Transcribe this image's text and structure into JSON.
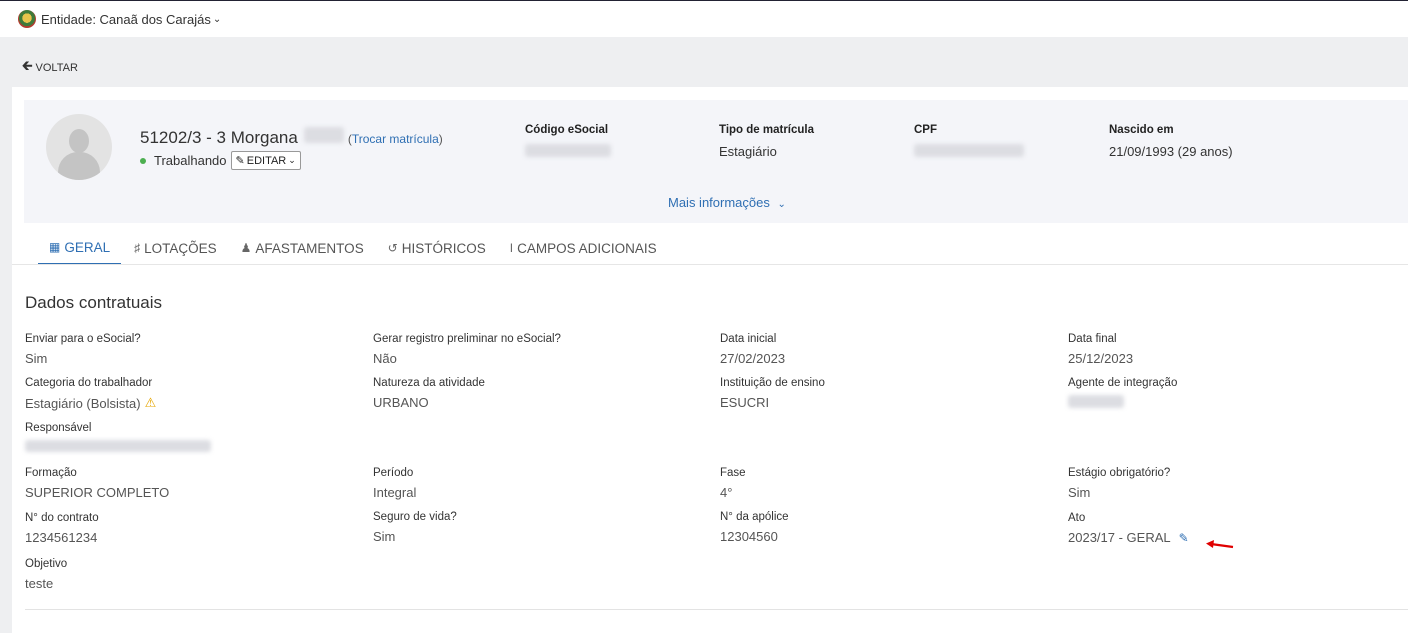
{
  "topbar": {
    "entity_label": "Entidade: Canaã dos Carajás"
  },
  "nav": {
    "back_label": "VOLTAR"
  },
  "profile": {
    "name": "51202/3 - 3 Morgana",
    "trocar_prefix": "(",
    "trocar_link": "Trocar matrícula",
    "trocar_suffix": ")",
    "status": "Trabalhando",
    "edit_label": "EDITAR",
    "fields": {
      "codigo_label": "Código eSocial",
      "tipo_label": "Tipo de matrícula",
      "tipo_value": "Estagiário",
      "cpf_label": "CPF",
      "nascido_label": "Nascido em",
      "nascido_value": "21/09/1993 (29 anos)"
    },
    "mais_info": "Mais informações"
  },
  "tabs": [
    {
      "label": "GERAL",
      "icon": "id-card-icon"
    },
    {
      "label": "LOTAÇÕES",
      "icon": "sitemap-icon"
    },
    {
      "label": "AFASTAMENTOS",
      "icon": "user-x-icon"
    },
    {
      "label": "HISTÓRICOS",
      "icon": "history-icon"
    },
    {
      "label": "CAMPOS ADICIONAIS",
      "icon": "text-cursor-icon"
    }
  ],
  "section": {
    "title": "Dados contratuais",
    "fields": {
      "enviar_l": "Enviar para o eSocial?",
      "enviar_v": "Sim",
      "gerar_l": "Gerar registro preliminar no eSocial?",
      "gerar_v": "Não",
      "dtini_l": "Data inicial",
      "dtini_v": "27/02/2023",
      "dtfim_l": "Data final",
      "dtfim_v": "25/12/2023",
      "categoria_l": "Categoria do trabalhador",
      "categoria_v": "Estagiário (Bolsista)",
      "natureza_l": "Natureza da atividade",
      "natureza_v": "URBANO",
      "instituicao_l": "Instituição de ensino",
      "instituicao_v": "ESUCRI",
      "agente_l": "Agente de integração",
      "responsavel_l": "Responsável",
      "formacao_l": "Formação",
      "formacao_v": "SUPERIOR COMPLETO",
      "periodo_l": "Período",
      "periodo_v": "Integral",
      "fase_l": "Fase",
      "fase_v": "4°",
      "estagio_l": "Estágio obrigatório?",
      "estagio_v": "Sim",
      "contrato_l": "N° do contrato",
      "contrato_v": "1234561234",
      "seguro_l": "Seguro de vida?",
      "seguro_v": "Sim",
      "apolice_l": "N° da apólice",
      "apolice_v": "12304560",
      "ato_l": "Ato",
      "ato_v": "2023/17 - GERAL",
      "objetivo_l": "Objetivo",
      "objetivo_v": "teste"
    }
  },
  "colors": {
    "accent": "#2f6fb3",
    "status_green": "#4caf50",
    "warning": "#e6a600",
    "annotation_red": "#e00000"
  }
}
